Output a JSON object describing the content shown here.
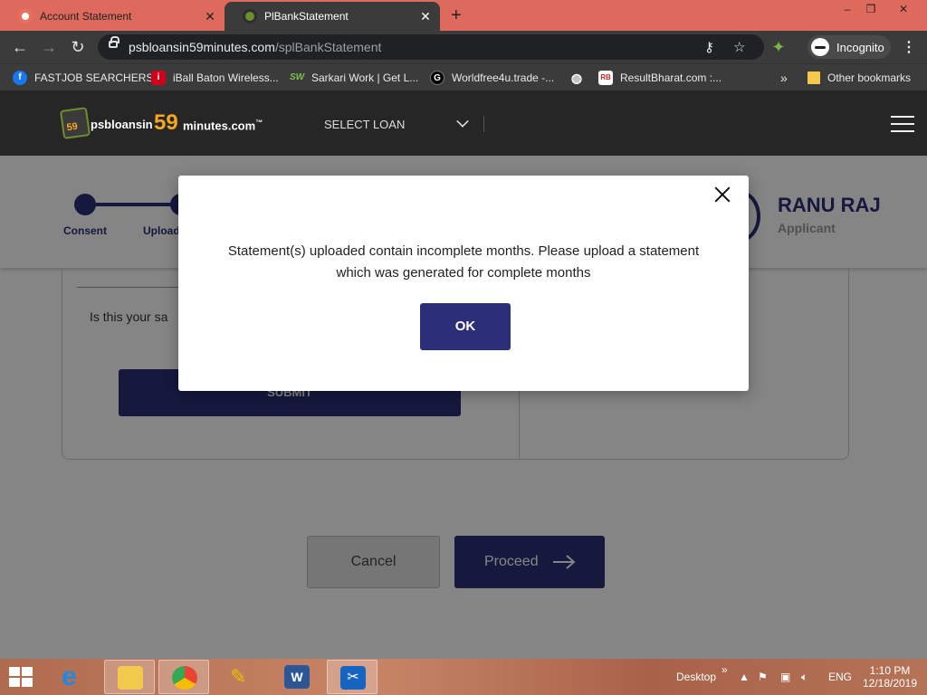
{
  "browser": {
    "tabs": [
      {
        "label": "Account Statement",
        "close": "✕"
      },
      {
        "label": "PlBankStatement",
        "close": "✕"
      }
    ],
    "new_tab": "+",
    "window_controls": {
      "minimize": "–",
      "restore": "❐",
      "close": "✕"
    },
    "url_domain": "psbloansin59minutes.com",
    "url_path": "/splBankStatement",
    "incognito_label": "Incognito",
    "bookmarks": [
      {
        "label": "FASTJOB SEARCHERS",
        "icon": "facebook-icon",
        "color": "#1877f2",
        "glyph": "f"
      },
      {
        "label": "iBall Baton Wireless...",
        "icon": "iball-icon",
        "color": "#d0021b",
        "glyph": "i"
      },
      {
        "label": "Sarkari Work | Get L...",
        "icon": "sarkari-icon",
        "color": "#2e7d32",
        "glyph": "SW"
      },
      {
        "label": "Worldfree4u.trade -...",
        "icon": "worldfree-icon",
        "color": "#000000",
        "glyph": "G"
      },
      {
        "label": "",
        "icon": "globe-icon",
        "color": "#555555",
        "glyph": "◍"
      },
      {
        "label": "ResultBharat.com :...",
        "icon": "resultbharat-icon",
        "color": "#c62828",
        "glyph": "RB"
      }
    ],
    "bookmarks_overflow": "»",
    "other_bookmarks": "Other bookmarks"
  },
  "site": {
    "logo_badge": "59",
    "logo_prefix": "psbloansin",
    "logo_number": "59",
    "logo_suffix": "minutes.com",
    "logo_tm": "™",
    "select_loan": "SELECT LOAN"
  },
  "stepper": {
    "steps": [
      "Consent",
      "Upload"
    ],
    "user_name": "RANU RAJ",
    "user_role": "Applicant"
  },
  "card": {
    "question": "Is this your sa",
    "submit_label": "SUBMIT"
  },
  "actions": {
    "cancel": "Cancel",
    "proceed": "Proceed"
  },
  "modal": {
    "message": "Statement(s) uploaded contain incomplete months. Please upload a statement which was generated for complete months",
    "ok_label": "OK"
  },
  "taskbar": {
    "desktop_label": "Desktop",
    "overflow": "»",
    "language": "ENG",
    "time": "1:10 PM",
    "date": "12/18/2019"
  },
  "colors": {
    "tab_bar": "#dd6a5c",
    "chrome_dark": "#3b3b3b",
    "site_header": "#262626",
    "primary": "#2b2f77",
    "accent": "#f5a623"
  }
}
